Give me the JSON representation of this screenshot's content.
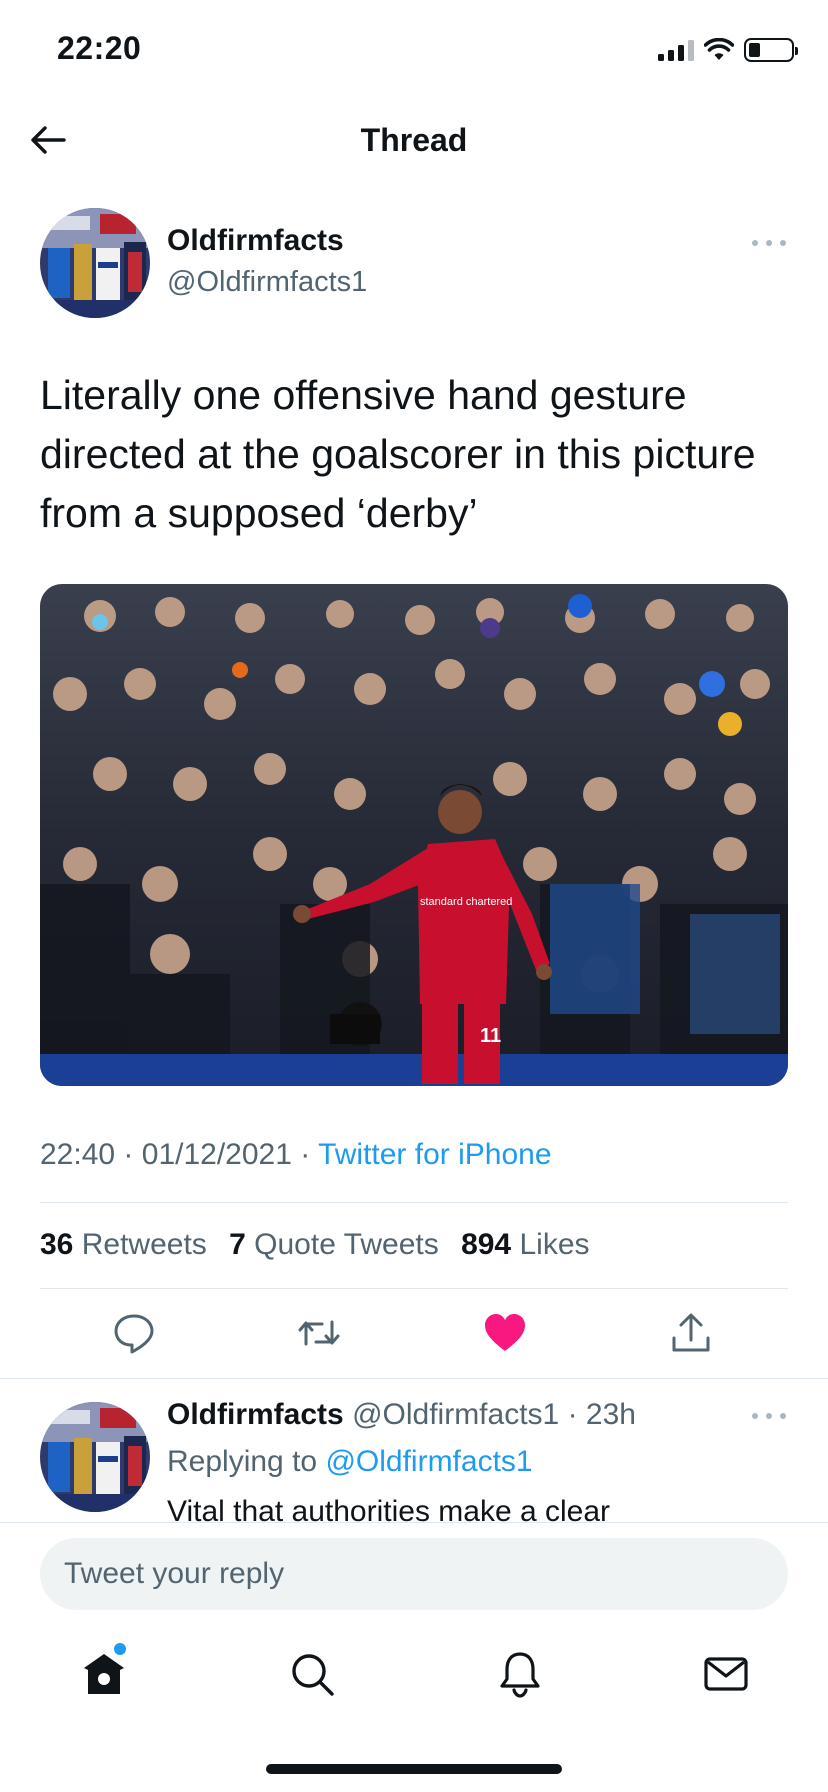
{
  "status_bar": {
    "time": "22:20"
  },
  "header": {
    "title": "Thread"
  },
  "tweet": {
    "author_name": "Oldfirmfacts",
    "author_handle": "@Oldfirmfacts1",
    "text": "Literally one offensive hand gesture directed at the goalscorer in this picture from a supposed ‘derby’",
    "image_text": {
      "sponsor": "standard chartered",
      "shirt_number": "11"
    },
    "time": "22:40",
    "separator": "·",
    "date": "01/12/2021",
    "source": "Twitter for iPhone",
    "stats": {
      "retweets_count": "36",
      "retweets_label": "Retweets",
      "quotes_count": "7",
      "quotes_label": "Quote Tweets",
      "likes_count": "894",
      "likes_label": "Likes"
    },
    "liked": true
  },
  "reply": {
    "author_name": "Oldfirmfacts",
    "author_handle": "@Oldfirmfacts1",
    "time_ago": "· 23h",
    "replying_prefix": "Replying to",
    "replying_to": "@Oldfirmfacts1",
    "text": "Vital that authorities make a clear"
  },
  "composer": {
    "placeholder": "Tweet your reply"
  },
  "tabs": [
    "home-icon",
    "search-icon",
    "notifications-icon",
    "messages-icon"
  ],
  "colors": {
    "accent": "#1d9bf0",
    "like": "#f91880",
    "text": "#0f1419",
    "muted": "#536471",
    "shirt": "#c8102e"
  }
}
